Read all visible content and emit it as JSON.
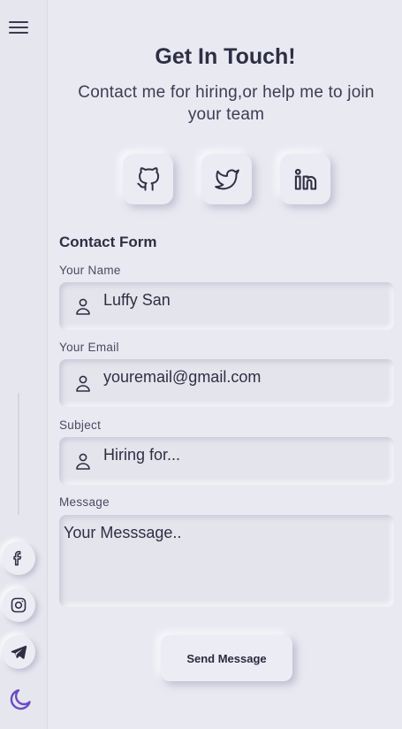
{
  "header": {
    "title": "Get In Touch!",
    "subtitle": "Contact me for hiring,or help me to join your team"
  },
  "profile_links": [
    {
      "name": "github",
      "icon": "github-icon"
    },
    {
      "name": "twitter",
      "icon": "twitter-icon"
    },
    {
      "name": "linkedin",
      "icon": "linkedin-icon"
    }
  ],
  "sidebar": {
    "icons": [
      "menu-icon",
      "facebook-icon",
      "instagram-icon",
      "telegram-icon",
      "moon-icon"
    ]
  },
  "form": {
    "title": "Contact Form",
    "name_label": "Your Name",
    "name_value": "Luffy San",
    "email_label": "Your Email",
    "email_value": "youremail@gmail.com",
    "subject_label": "Subject",
    "subject_value": "Hiring for...",
    "message_label": "Message",
    "message_value": "Your Messsage..",
    "submit_label": "Send Message"
  },
  "colors": {
    "background": "#e9e9f2",
    "text": "#2e2e44",
    "accent": "#6a4bc4"
  }
}
